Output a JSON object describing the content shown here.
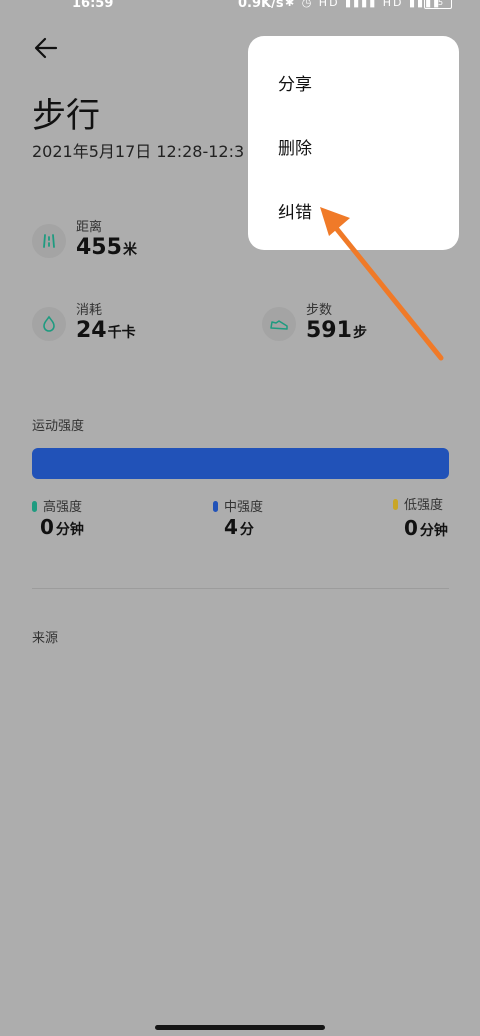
{
  "status_bar": {
    "time": "16:59",
    "net_speed": "0.9K/s",
    "icons": "✱ ◷ HD ▮▮▮▮ HD ▮▮▮▮",
    "battery": "75"
  },
  "header": {
    "title": "步行",
    "datetime": "2021年5月17日 12:28-12:3"
  },
  "stats": {
    "distance": {
      "label": "距离",
      "value": "455",
      "unit": "米"
    },
    "calories": {
      "label": "消耗",
      "value": "24",
      "unit": "千卡"
    },
    "steps": {
      "label": "步数",
      "value": "591",
      "unit": "步"
    }
  },
  "intensity": {
    "label": "运动强度",
    "bar_color": "#2152b8",
    "levels": [
      {
        "name": "高强度",
        "value": "0",
        "unit": "分钟",
        "color": "#1f9b80"
      },
      {
        "name": "中强度",
        "value": "4",
        "unit": "分",
        "color": "#2152b8"
      },
      {
        "name": "低强度",
        "value": "0",
        "unit": "分钟",
        "color": "#c9a626"
      }
    ]
  },
  "source": {
    "label": "来源"
  },
  "menu": {
    "items": [
      "分享",
      "删除",
      "纠错"
    ]
  },
  "annotation": {
    "color": "#f07a28"
  }
}
